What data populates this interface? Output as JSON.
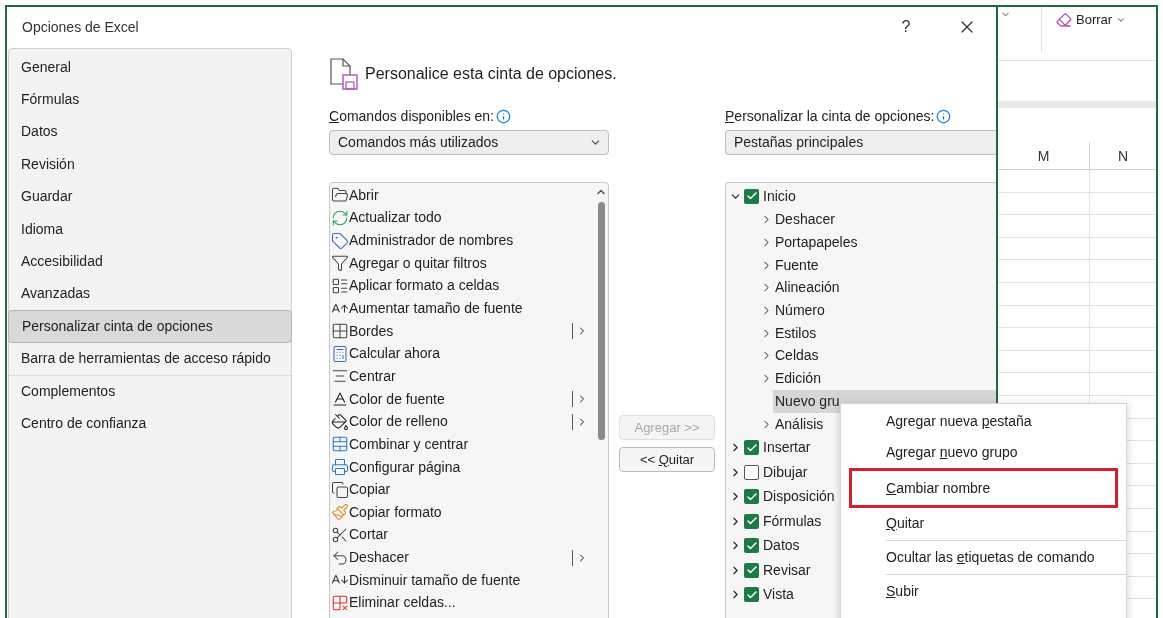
{
  "window": {
    "title": "Opciones de Excel",
    "help": "?"
  },
  "sidebar": {
    "items": [
      {
        "label": "General",
        "selected": false,
        "separator_before": false
      },
      {
        "label": "Fórmulas",
        "selected": false,
        "separator_before": false
      },
      {
        "label": "Datos",
        "selected": false,
        "separator_before": false
      },
      {
        "label": "Revisión",
        "selected": false,
        "separator_before": false
      },
      {
        "label": "Guardar",
        "selected": false,
        "separator_before": false
      },
      {
        "label": "Idioma",
        "selected": false,
        "separator_before": false
      },
      {
        "label": "Accesibilidad",
        "selected": false,
        "separator_before": false
      },
      {
        "label": "Avanzadas",
        "selected": false,
        "separator_before": false
      },
      {
        "label": "Personalizar cinta de opciones",
        "selected": true,
        "separator_before": false
      },
      {
        "label": "Barra de herramientas de acceso rápido",
        "selected": false,
        "separator_before": false
      },
      {
        "label": "Complementos",
        "selected": false,
        "separator_before": true
      },
      {
        "label": "Centro de confianza",
        "selected": false,
        "separator_before": false
      }
    ]
  },
  "heading": "Personalice esta cinta de opciones.",
  "commands": {
    "label": {
      "key": "C",
      "post": "omandos disponibles en:"
    },
    "dropdown": "Comandos más utilizados",
    "items": [
      {
        "label": "Abrir",
        "has_submenu": false
      },
      {
        "label": "Actualizar todo",
        "has_submenu": false
      },
      {
        "label": "Administrador de nombres",
        "has_submenu": false
      },
      {
        "label": "Agregar o quitar filtros",
        "has_submenu": false
      },
      {
        "label": "Aplicar formato a celdas",
        "has_submenu": false
      },
      {
        "label": "Aumentar tamaño de fuente",
        "has_submenu": false
      },
      {
        "label": "Bordes",
        "has_submenu": true
      },
      {
        "label": "Calcular ahora",
        "has_submenu": false
      },
      {
        "label": "Centrar",
        "has_submenu": false
      },
      {
        "label": "Color de fuente",
        "has_submenu": true
      },
      {
        "label": "Color de relleno",
        "has_submenu": true
      },
      {
        "label": "Combinar y centrar",
        "has_submenu": false
      },
      {
        "label": "Configurar página",
        "has_submenu": false
      },
      {
        "label": "Copiar",
        "has_submenu": false
      },
      {
        "label": "Copiar formato",
        "has_submenu": false
      },
      {
        "label": "Cortar",
        "has_submenu": false
      },
      {
        "label": "Deshacer",
        "has_submenu": true
      },
      {
        "label": "Disminuir tamaño de fuente",
        "has_submenu": false
      },
      {
        "label": "Eliminar celdas...",
        "has_submenu": false
      }
    ]
  },
  "move_buttons": [
    {
      "label": {
        "pre": "Agregar >>"
      },
      "disabled": true
    },
    {
      "label": {
        "pre": "<< ",
        "key": "Q",
        "post": "uitar"
      },
      "disabled": false
    }
  ],
  "ribbon": {
    "label": {
      "key": "P",
      "post": "ersonalizar la cinta de opciones:"
    },
    "dropdown": "Pestañas principales",
    "tabs": [
      {
        "label": "Inicio",
        "checked": true,
        "expanded": true,
        "selected": false,
        "children": [
          {
            "label": "Deshacer",
            "expandable": true,
            "selected": false
          },
          {
            "label": "Portapapeles",
            "expandable": true,
            "selected": false
          },
          {
            "label": "Fuente",
            "expandable": true,
            "selected": false
          },
          {
            "label": "Alineación",
            "expandable": true,
            "selected": false
          },
          {
            "label": "Número",
            "expandable": true,
            "selected": false
          },
          {
            "label": "Estilos",
            "expandable": true,
            "selected": false
          },
          {
            "label": "Celdas",
            "expandable": true,
            "selected": false
          },
          {
            "label": "Edición",
            "expandable": true,
            "selected": false
          },
          {
            "label": "Nuevo gru",
            "expandable": false,
            "selected": true
          },
          {
            "label": "Análisis",
            "expandable": true,
            "selected": false
          }
        ]
      },
      {
        "label": "Insertar",
        "checked": true,
        "expanded": false,
        "selected": false
      },
      {
        "label": "Dibujar",
        "checked": false,
        "expanded": false,
        "selected": false
      },
      {
        "label": "Disposición",
        "checked": true,
        "expanded": false,
        "selected": false
      },
      {
        "label": "Fórmulas",
        "checked": true,
        "expanded": false,
        "selected": false
      },
      {
        "label": "Datos",
        "checked": true,
        "expanded": false,
        "selected": false
      },
      {
        "label": "Revisar",
        "checked": true,
        "expanded": false,
        "selected": false
      },
      {
        "label": "Vista",
        "checked": true,
        "expanded": false,
        "selected": false
      }
    ]
  },
  "context_menu": [
    {
      "label": {
        "pre": "Agregar nueva ",
        "key": "p",
        "post": "estaña"
      },
      "highlighted": false,
      "separator_before": false
    },
    {
      "label": {
        "pre": "Agregar ",
        "key": "n",
        "post": "uevo grupo"
      },
      "highlighted": false,
      "separator_before": false
    },
    {
      "label": {
        "key": "C",
        "post": "ambiar nombre"
      },
      "highlighted": true,
      "separator_before": false
    },
    {
      "label": {
        "key": "Q",
        "post": "uitar"
      },
      "highlighted": false,
      "separator_before": false
    },
    {
      "label": {
        "pre": "Ocultar las ",
        "key": "e",
        "post": "tiquetas de comando"
      },
      "highlighted": false,
      "separator_before": true
    },
    {
      "label": {
        "key": "S",
        "post": "ubir"
      },
      "highlighted": false,
      "separator_before": true
    }
  ],
  "excel": {
    "ribbon_button": "Borrar",
    "columns": [
      "M",
      "N"
    ]
  }
}
